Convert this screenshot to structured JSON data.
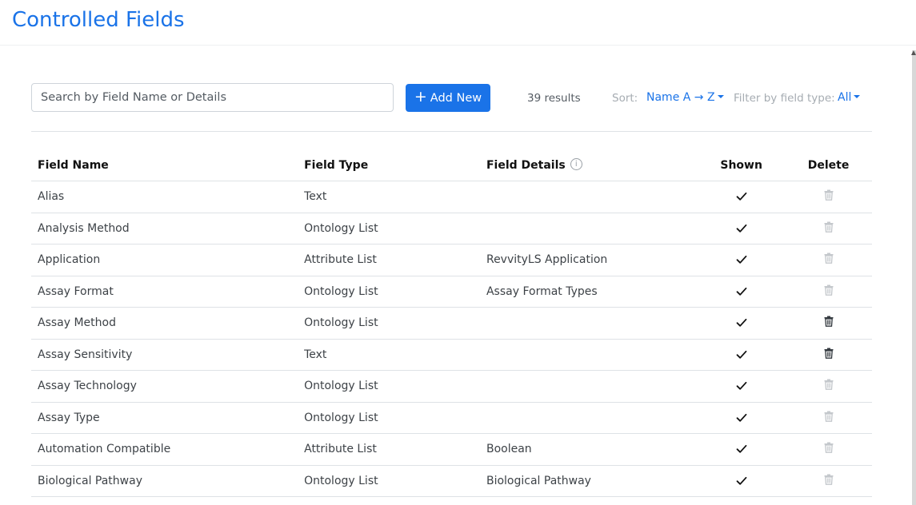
{
  "header": {
    "title": "Controlled Fields"
  },
  "toolbar": {
    "search_placeholder": "Search by Field Name or Details",
    "search_value": "",
    "add_label": "Add New",
    "results": "39 results",
    "sort_label": "Sort:",
    "sort_value": "Name A → Z",
    "filter_label": "Filter by field type:",
    "filter_value": "All"
  },
  "table": {
    "headers": {
      "name": "Field Name",
      "type": "Field Type",
      "details": "Field Details",
      "shown": "Shown",
      "delete": "Delete"
    },
    "rows": [
      {
        "name": "Alias",
        "type": "Text",
        "details": "",
        "shown": true,
        "deletable": false
      },
      {
        "name": "Analysis Method",
        "type": "Ontology List",
        "details": "",
        "shown": true,
        "deletable": false
      },
      {
        "name": "Application",
        "type": "Attribute List",
        "details": "RevvityLS Application",
        "shown": true,
        "deletable": false
      },
      {
        "name": "Assay Format",
        "type": "Ontology List",
        "details": "Assay Format Types",
        "shown": true,
        "deletable": false
      },
      {
        "name": "Assay Method",
        "type": "Ontology List",
        "details": "",
        "shown": true,
        "deletable": true
      },
      {
        "name": "Assay Sensitivity",
        "type": "Text",
        "details": "",
        "shown": true,
        "deletable": true
      },
      {
        "name": "Assay Technology",
        "type": "Ontology List",
        "details": "",
        "shown": true,
        "deletable": false
      },
      {
        "name": "Assay Type",
        "type": "Ontology List",
        "details": "",
        "shown": true,
        "deletable": false
      },
      {
        "name": "Automation Compatible",
        "type": "Attribute List",
        "details": "Boolean",
        "shown": true,
        "deletable": false
      },
      {
        "name": "Biological Pathway",
        "type": "Ontology List",
        "details": "Biological Pathway",
        "shown": true,
        "deletable": false
      }
    ]
  },
  "colors": {
    "accent": "#1a73e8",
    "trash_enabled": "#343a40",
    "trash_disabled": "#c4c8cc"
  },
  "icons": {
    "add": "plus-icon",
    "info": "info-icon",
    "shown": "check-icon",
    "delete": "trash-icon"
  }
}
